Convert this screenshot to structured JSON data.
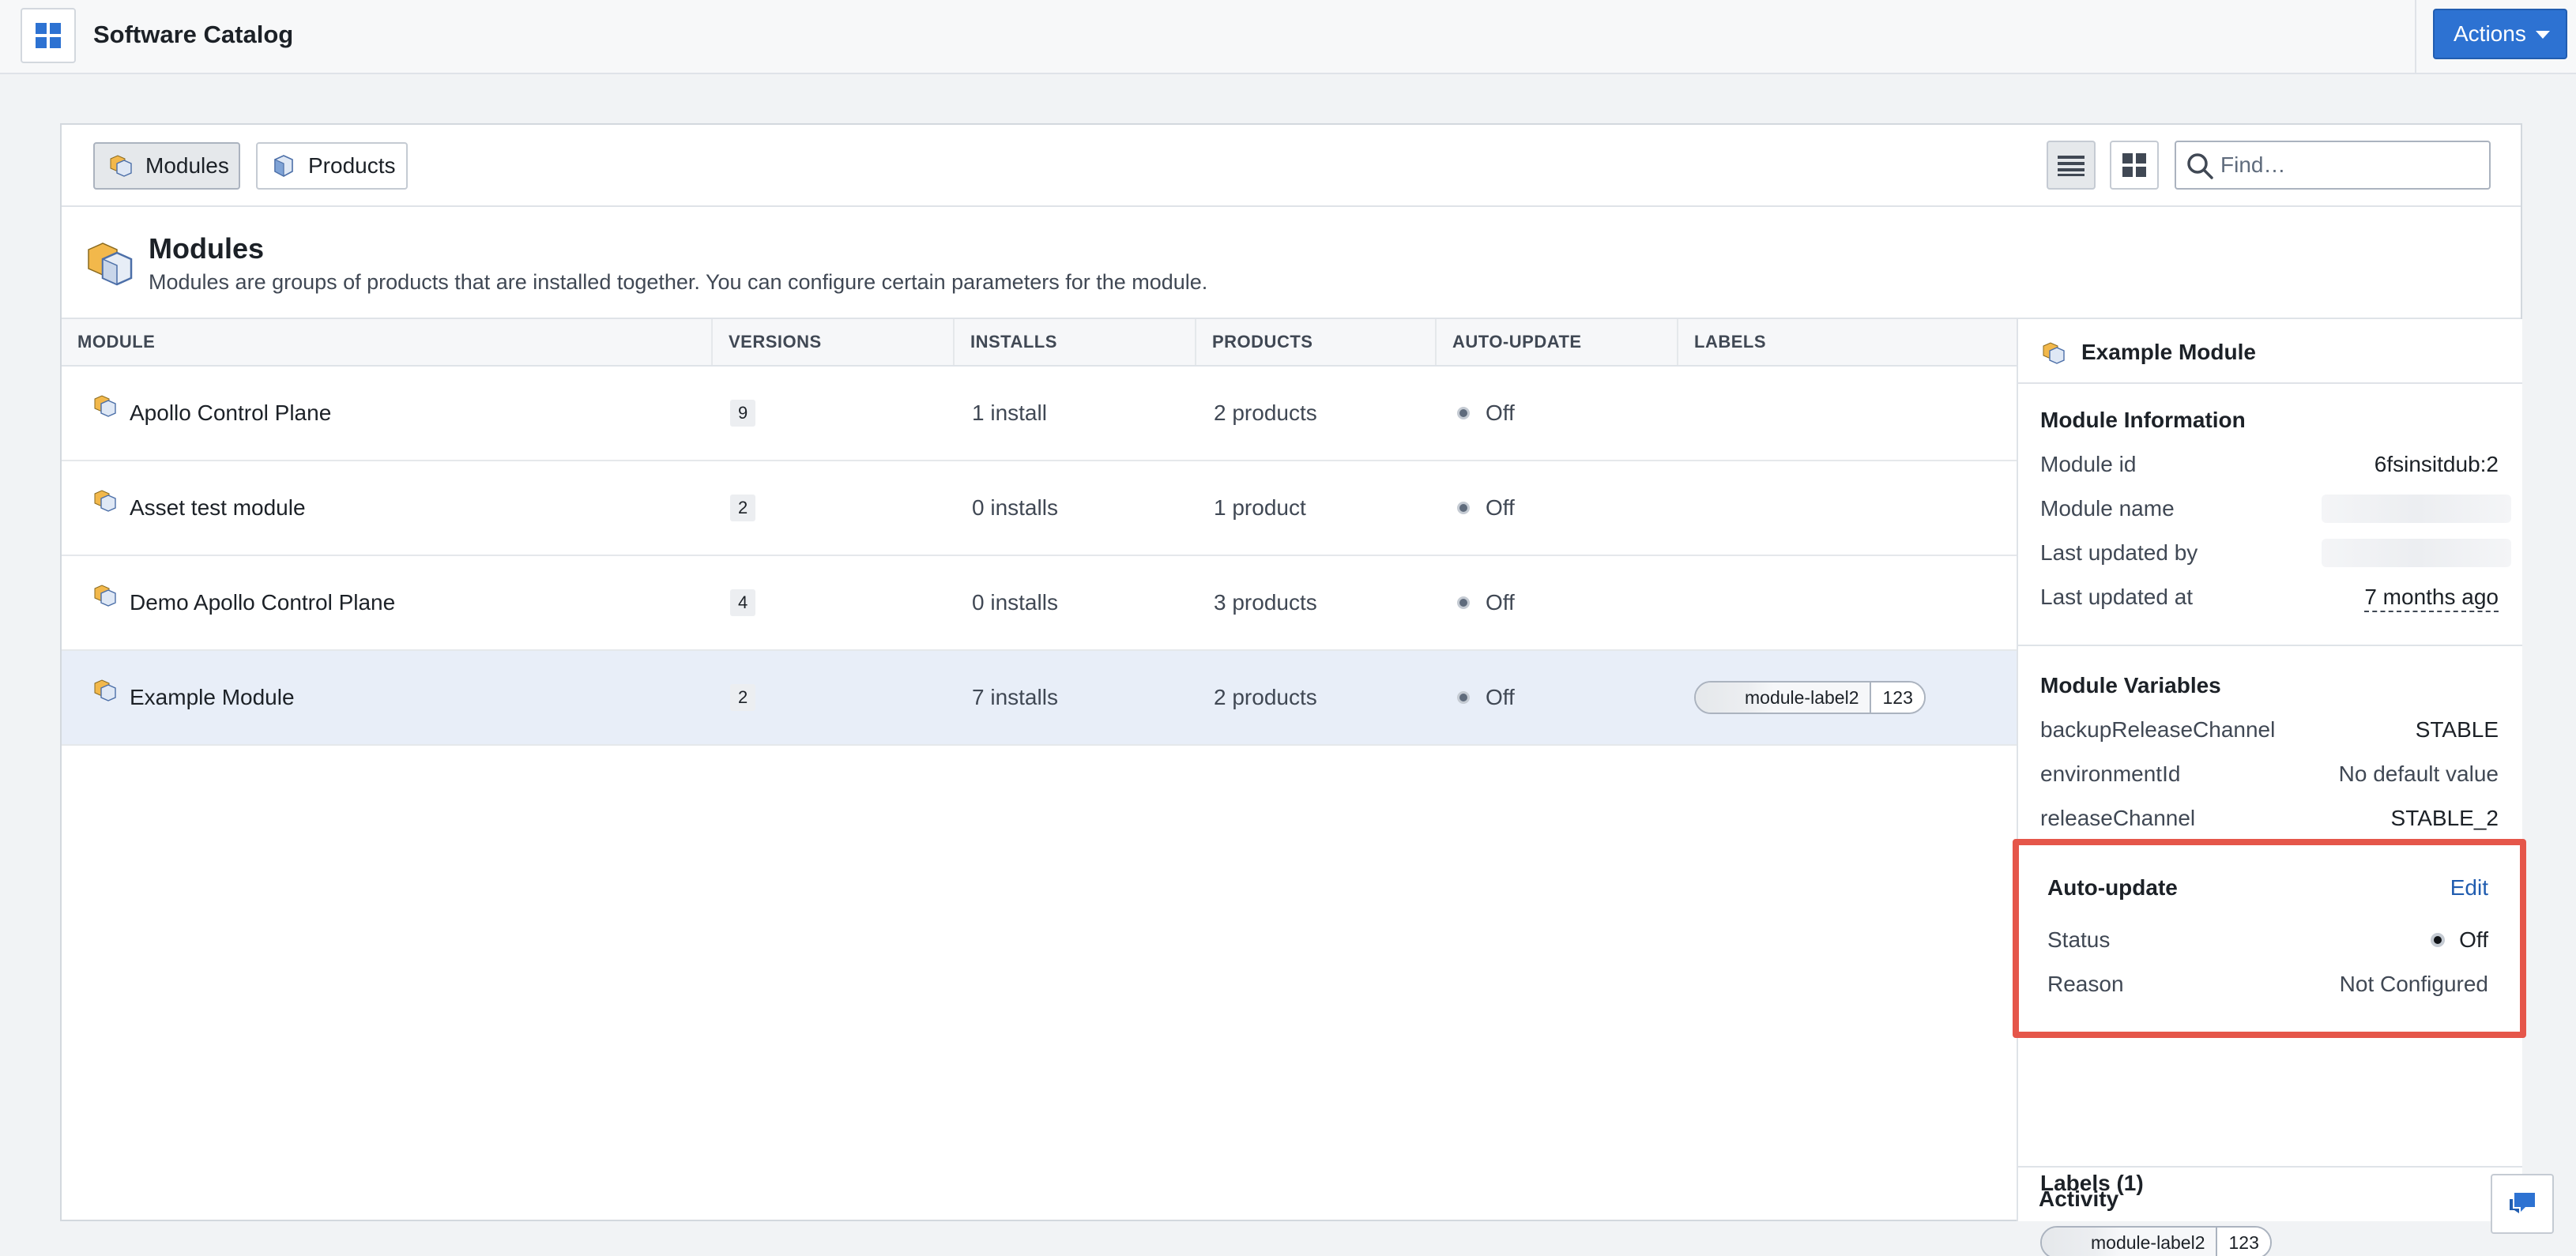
{
  "header": {
    "title": "Software Catalog",
    "actions_label": "Actions"
  },
  "toolbar": {
    "tabs": [
      {
        "label": "Modules",
        "active": true
      },
      {
        "label": "Products",
        "active": false
      }
    ],
    "search_placeholder": "Find…"
  },
  "section": {
    "title": "Modules",
    "description": "Modules are groups of products that are installed together. You can configure certain parameters for the module."
  },
  "table": {
    "columns": [
      "MODULE",
      "VERSIONS",
      "INSTALLS",
      "PRODUCTS",
      "AUTO-UPDATE",
      "LABELS"
    ],
    "rows": [
      {
        "module": "Apollo Control Plane",
        "versions": "9",
        "installs": "1 install",
        "products": "2 products",
        "auto_update": "Off",
        "label": "",
        "label_count": ""
      },
      {
        "module": "Asset test module",
        "versions": "2",
        "installs": "0 installs",
        "products": "1 product",
        "auto_update": "Off",
        "label": "",
        "label_count": ""
      },
      {
        "module": "Demo Apollo Control Plane",
        "versions": "4",
        "installs": "0 installs",
        "products": "3 products",
        "auto_update": "Off",
        "label": "",
        "label_count": ""
      },
      {
        "module": "Example Module",
        "versions": "2",
        "installs": "7 installs",
        "products": "2 products",
        "auto_update": "Off",
        "label": "module-label2",
        "label_count": "123",
        "selected": true
      }
    ]
  },
  "panel": {
    "title": "Example Module",
    "info_title": "Module Information",
    "info": [
      {
        "label": "Module id",
        "value": "6fsinsitdub:2"
      },
      {
        "label": "Module name",
        "value": ""
      },
      {
        "label": "Last updated by",
        "value": ""
      },
      {
        "label": "Last updated at",
        "value": "7 months ago"
      }
    ],
    "vars_title": "Module Variables",
    "vars": [
      {
        "label": "backupReleaseChannel",
        "value": "STABLE"
      },
      {
        "label": "environmentId",
        "value": "No default value"
      },
      {
        "label": "releaseChannel",
        "value": "STABLE_2"
      }
    ],
    "auto_update": {
      "title": "Auto-update",
      "edit_label": "Edit",
      "status_label": "Status",
      "status_value": "Off",
      "reason_label": "Reason",
      "reason_value": "Not Configured"
    },
    "labels_title": "Labels (1)",
    "label_name": "module-label2",
    "label_count": "123",
    "activity_title": "Activity"
  },
  "colors": {
    "accent": "#2d72d2",
    "highlight": "#e5564a"
  }
}
